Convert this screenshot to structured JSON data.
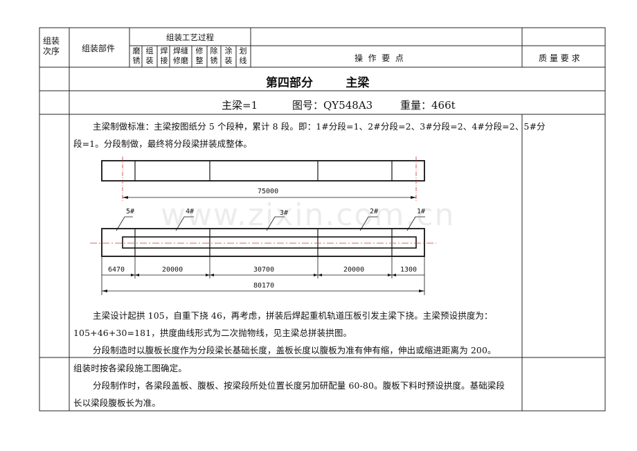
{
  "header": {
    "col_order": "组装\n次序",
    "col_part": "组装部件",
    "col_process": "组装工艺过程",
    "process_steps": [
      "磨\n锈",
      "组\n装",
      "焊\n接",
      "焊缝\n修磨",
      "修\n整",
      "除\n锈",
      "涂\n装",
      "划\n线"
    ],
    "col_operation": "操  作  要  点",
    "col_quality": "质 量 要 求"
  },
  "section": {
    "title": "第四部分        主梁",
    "main_beam": "主梁=1",
    "drawing_no": "图号：QY548A3",
    "weight": "重量：466t"
  },
  "body": {
    "para1_line1": "主梁制做标准：主梁按图纸分 5 个段种，累计 8 段。即：1#分段=1、2#分段=2、3#分段=2、4#分段=2、5#分",
    "para1_line2": "段=1。分段制做，最终将分段梁拼装成整体。",
    "para2_line1": "主梁设计起拱 105，自重下挠 46，再考虑，拼装后焊起重机轨道压板引发主梁下挠。主梁预设拱度为：",
    "para2_line2": "105+46+30=181，拱度曲线形式为二次抛物线，见主梁总拼装拱图。",
    "para3": "分段制造时以腹板长度作为分段梁长基础长度，盖板长度以腹板为准有伸有缩，伸出或缩进距离为 200。",
    "para4": "组装时按各梁段施工图确定。",
    "para5_line1": "分段制作时，各梁段盖板、腹板、按梁段所处位置长度另加研配量 60-80。腹板下料时预设拱度。基础梁段",
    "para5_line2": "长以梁段腹板长为准。"
  },
  "drawing": {
    "overall_length": "75000",
    "segment_labels": [
      "5#",
      "4#",
      "3#",
      "2#",
      "1#"
    ],
    "segment_dims": [
      "6470",
      "20000",
      "30700",
      "20000",
      "1300"
    ],
    "total_length": "80170"
  },
  "watermark": "www.zixin.com.cn"
}
